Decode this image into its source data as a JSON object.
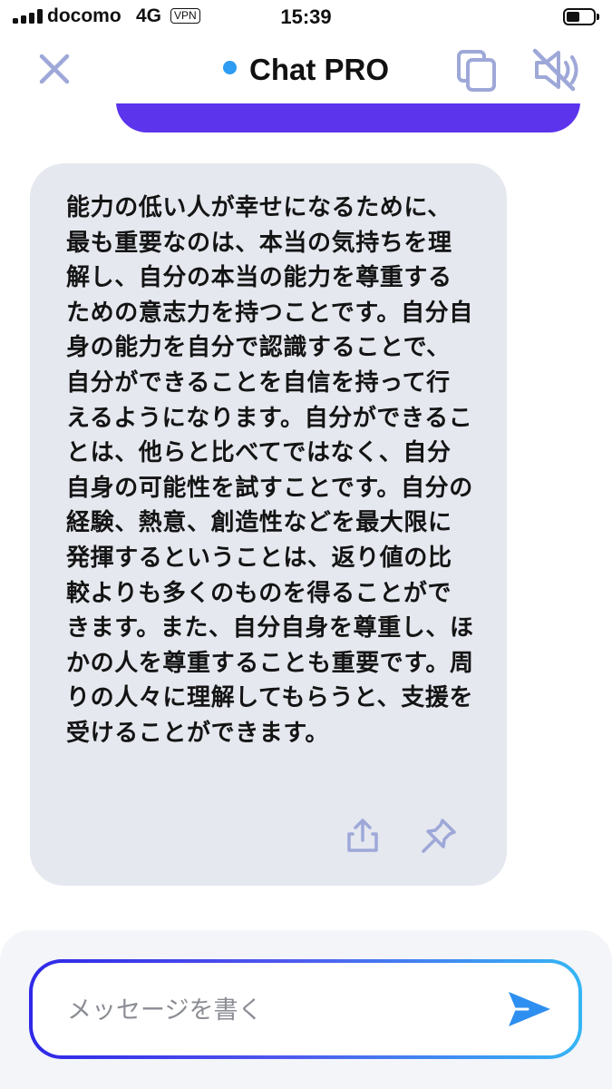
{
  "status_bar": {
    "carrier": "docomo",
    "network": "4G",
    "vpn": "VPN",
    "time": "15:39",
    "battery_level": 0.5
  },
  "header": {
    "title": "Chat PRO",
    "online_color": "#2d9cf2",
    "icons": [
      "close-icon",
      "copy-icon",
      "speaker-muted-icon"
    ]
  },
  "messages": [
    {
      "role": "user",
      "color": "#5b34ec"
    },
    {
      "role": "assistant",
      "text": "能力の低い人が幸せになるために、最も重要なのは、本当の気持ちを理解し、自分の本当の能力を尊重するための意志力を持つことです。自分自身の能力を自分で認識することで、自分ができることを自信を持って行えるようになります。自分ができることは、他らと比べてではなく、自分自身の可能性を試すことです。自分の経験、熱意、創造性などを最大限に発揮するということは、返り値の比較よりも多くのものを得ることができます。また、自分自身を尊重し、ほかの人を尊重することも重要です。周りの人々に理解してもらうと、支援を受けることができます。",
      "actions": [
        "share-icon",
        "pin-icon"
      ]
    }
  ],
  "composer": {
    "placeholder": "メッセージを書く",
    "value": "",
    "send_icon": "send-icon"
  }
}
